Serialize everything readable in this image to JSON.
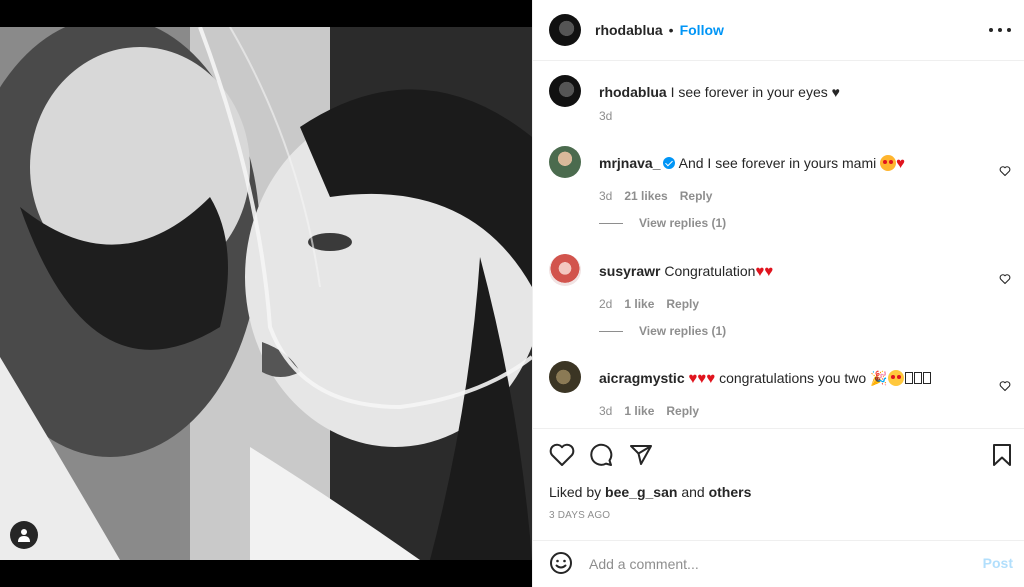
{
  "post": {
    "owner": "rhodablua",
    "separator": "•",
    "follow_label": "Follow",
    "more_icon": "more-horizontal-icon"
  },
  "caption": {
    "username": "rhodablua",
    "text": "I see forever in your eyes ♥",
    "age": "3d"
  },
  "comments": [
    {
      "username": "mrjnava_",
      "verified": true,
      "text": "And I see forever in yours mami",
      "emojis": [
        "heart-eyes-face",
        "red-heart"
      ],
      "age": "3d",
      "likes": "21 likes",
      "reply_label": "Reply",
      "view_replies": "View replies (1)"
    },
    {
      "username": "susyrawr",
      "text": "Congratulation",
      "emojis": [
        "red-heart",
        "red-heart"
      ],
      "age": "2d",
      "likes": "1 like",
      "reply_label": "Reply",
      "view_replies": "View replies (1)"
    },
    {
      "username": "aicragmystic",
      "text": "congratulations you two",
      "emojis_before": [
        "red-heart",
        "red-heart",
        "red-heart"
      ],
      "emojis_after": [
        "party-popper",
        "face-with-hat",
        "missing-glyph",
        "missing-glyph",
        "missing-glyph"
      ],
      "age": "3d",
      "likes": "1 like",
      "reply_label": "Reply"
    }
  ],
  "actions": {
    "like_icon": "heart-icon",
    "comment_icon": "comment-icon",
    "share_icon": "send-icon",
    "save_icon": "bookmark-icon"
  },
  "liked_by": {
    "prefix": "Liked by",
    "user": "bee_g_san",
    "conjunction": "and",
    "others": "others"
  },
  "date": "3 DAYS AGO",
  "add_comment": {
    "placeholder": "Add a comment...",
    "post_label": "Post"
  },
  "colors": {
    "accent": "#0095f6",
    "post_disabled": "#b2dffc",
    "heart_red": "#e0141e",
    "muted": "#8e8e8e"
  }
}
